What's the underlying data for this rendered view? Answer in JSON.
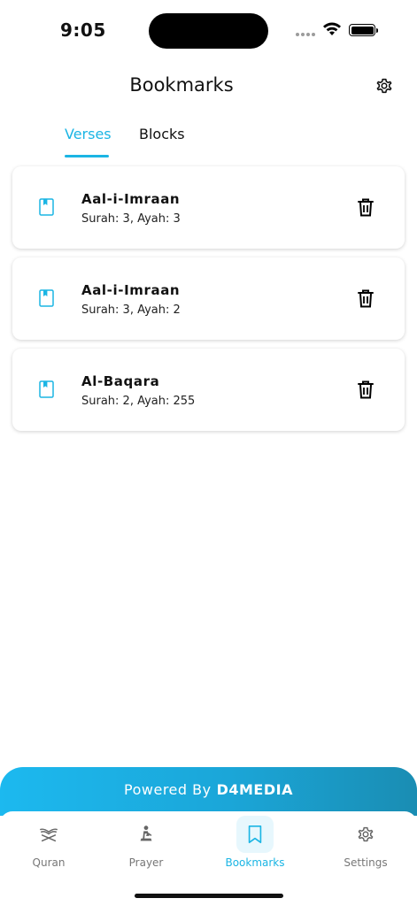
{
  "status_bar": {
    "time": "9:05",
    "battery_level": 1.0
  },
  "header": {
    "title": "Bookmarks",
    "settings_icon": "gear-icon"
  },
  "tabs": [
    {
      "label": "Verses",
      "active": true
    },
    {
      "label": "Blocks",
      "active": false
    }
  ],
  "bookmarks": [
    {
      "title": "Aal-i-Imraan",
      "subtitle": "Surah: 3, Ayah: 3",
      "icon": "book-icon"
    },
    {
      "title": "Aal-i-Imraan",
      "subtitle": "Surah: 3, Ayah: 2",
      "icon": "book-icon"
    },
    {
      "title": "Al-Baqara",
      "subtitle": "Surah: 2, Ayah: 255",
      "icon": "book-icon"
    }
  ],
  "banner": {
    "prefix": "Powered By",
    "brand": "D4MEDIA"
  },
  "bottom_nav": [
    {
      "label": "Quran",
      "icon": "quran-icon",
      "active": false
    },
    {
      "label": "Prayer",
      "icon": "prayer-icon",
      "active": false
    },
    {
      "label": "Bookmarks",
      "icon": "bookmark-icon",
      "active": true
    },
    {
      "label": "Settings",
      "icon": "gear-icon",
      "active": false
    }
  ],
  "colors": {
    "accent": "#1bb5e4",
    "banner_start": "#1cb9ef",
    "banner_end": "#1a8db3",
    "inactive": "#777777"
  }
}
